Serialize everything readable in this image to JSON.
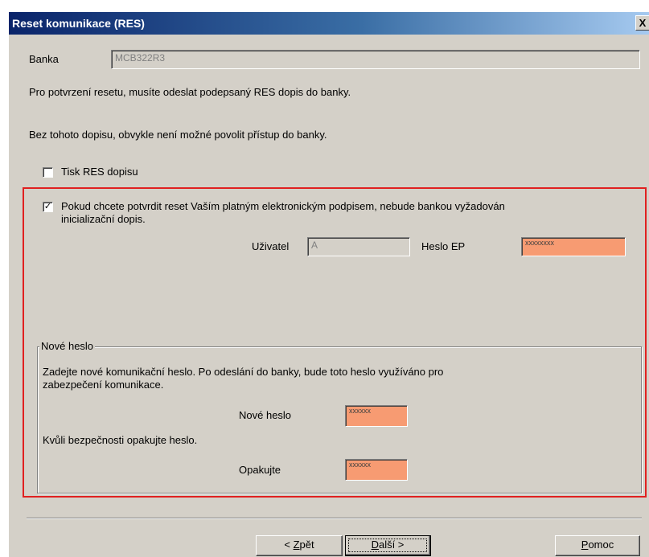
{
  "window": {
    "title": "Reset komunikace (RES)",
    "close_label": "X"
  },
  "bank": {
    "label": "Banka",
    "value": "MCB322R3"
  },
  "info": {
    "line1": "Pro potvrzení resetu, musíte odeslat podepsaný RES dopis do banky.",
    "line2": "Bez tohoto dopisu, obvykle není možné povolit přístup do banky."
  },
  "print_res": {
    "label": "Tisk RES dopisu",
    "checked": false
  },
  "signature": {
    "checked": true,
    "text_line1": "Pokud chcete potvrdit reset Vaším platným elektronickým podpisem, nebude bankou vyžadován",
    "text_line2": "inicializační dopis.",
    "user_label": "Uživatel",
    "user_value": "A",
    "password_label": "Heslo EP",
    "password_value": "xxxxxxxx"
  },
  "new_password": {
    "group_title": "Nové heslo",
    "desc_line1": "Zadejte nové komunikační heslo. Po odeslání do banky, bude toto heslo využíváno pro",
    "desc_line2": "zabezpečení komunikace.",
    "new_label": "Nové heslo",
    "new_value": "xxxxxx",
    "repeat_hint": "Kvůli bezpečnosti opakujte heslo.",
    "repeat_label": "Opakujte",
    "repeat_value": "xxxxxx"
  },
  "buttons": {
    "back_prefix": "< ",
    "back_key": "Z",
    "back_rest": "pět",
    "next_key": "D",
    "next_rest": "alší >",
    "help_key": "P",
    "help_rest": "omoc"
  },
  "colors": {
    "password_field": "#f79b72",
    "highlight_border": "#e02020",
    "dialog_bg": "#d4d0c8",
    "title_start": "#0a246a",
    "title_end": "#a6caf0"
  }
}
